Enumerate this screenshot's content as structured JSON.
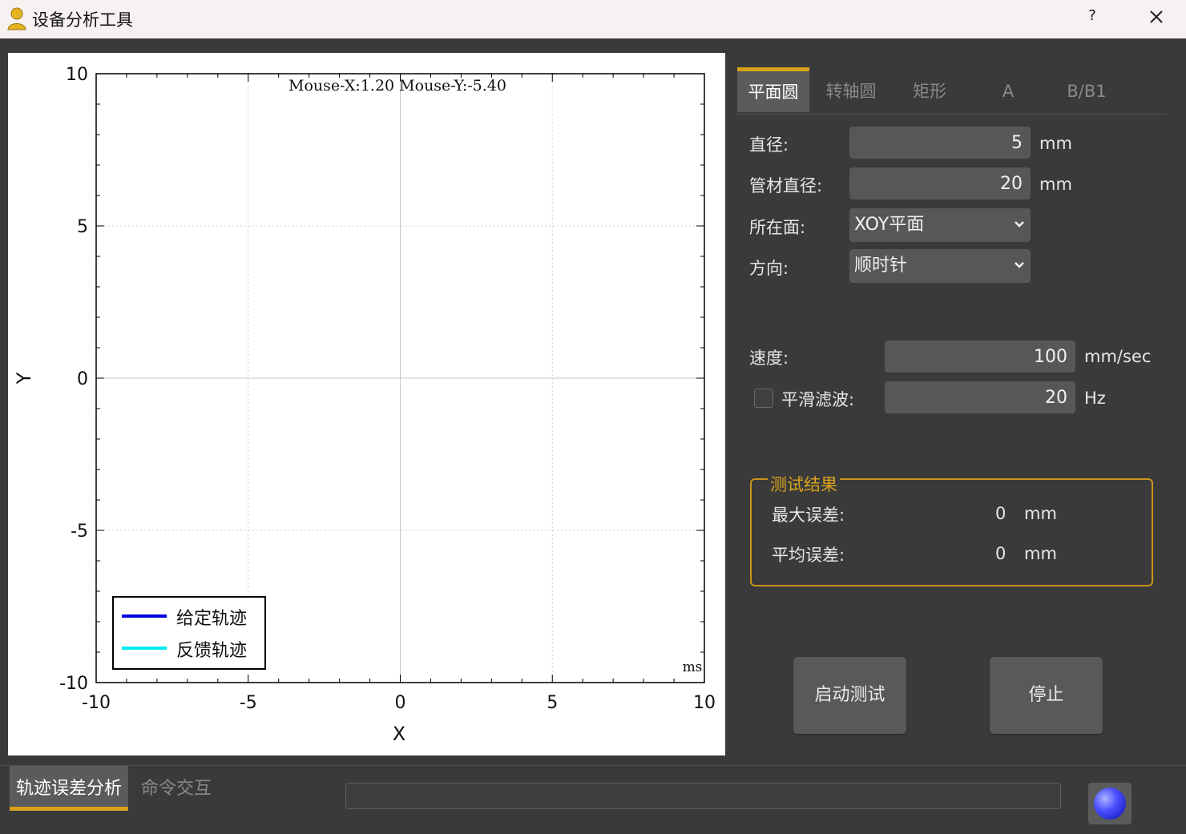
{
  "window": {
    "title": "设备分析工具",
    "help_label": "?"
  },
  "plot": {
    "mouse_readout": "Mouse-X:1.20 Mouse-Y:-5.40",
    "unit_label": "ms",
    "legend": [
      "给定轨迹",
      "反馈轨迹"
    ],
    "legend_colors": [
      "#0000e0",
      "#00eef0"
    ]
  },
  "chart_data": {
    "type": "line",
    "xlabel": "X",
    "ylabel": "Y",
    "xlim": [
      -10,
      10
    ],
    "ylim": [
      -10,
      10
    ],
    "x_ticks": [
      "-10",
      "-5",
      "0",
      "5",
      "10"
    ],
    "y_ticks": [
      "10",
      "5",
      "0",
      "-5",
      "-10"
    ],
    "grid": true,
    "legend_position": "bottom-left",
    "series": [
      {
        "name": "给定轨迹",
        "x": [],
        "y": []
      },
      {
        "name": "反馈轨迹",
        "x": [],
        "y": []
      }
    ]
  },
  "tabs": [
    "平面圆",
    "转轴圆",
    "矩形",
    "A",
    "B/B1"
  ],
  "form": {
    "diameter_label": "直径:",
    "diameter_value": "5",
    "diameter_unit": "mm",
    "tube_label": "管材直径:",
    "tube_value": "20",
    "tube_unit": "mm",
    "plane_label": "所在面:",
    "plane_value": "XOY平面",
    "direction_label": "方向:",
    "direction_value": "顺时针",
    "speed_label": "速度:",
    "speed_value": "100",
    "speed_unit": "mm/sec",
    "filter_label": "平滑滤波:",
    "filter_value": "20",
    "filter_unit": "Hz"
  },
  "results": {
    "title": "测试结果",
    "max_error_label": "最大误差:",
    "max_error_value": "0",
    "max_error_unit": "mm",
    "avg_error_label": "平均误差:",
    "avg_error_value": "0",
    "avg_error_unit": "mm"
  },
  "buttons": {
    "start": "启动测试",
    "stop": "停止"
  },
  "bottom_tabs": [
    "轨迹误差分析",
    "命令交互"
  ],
  "colors": {
    "accent": "#d9a21a",
    "background": "#3a3a3a",
    "field": "#575757"
  }
}
